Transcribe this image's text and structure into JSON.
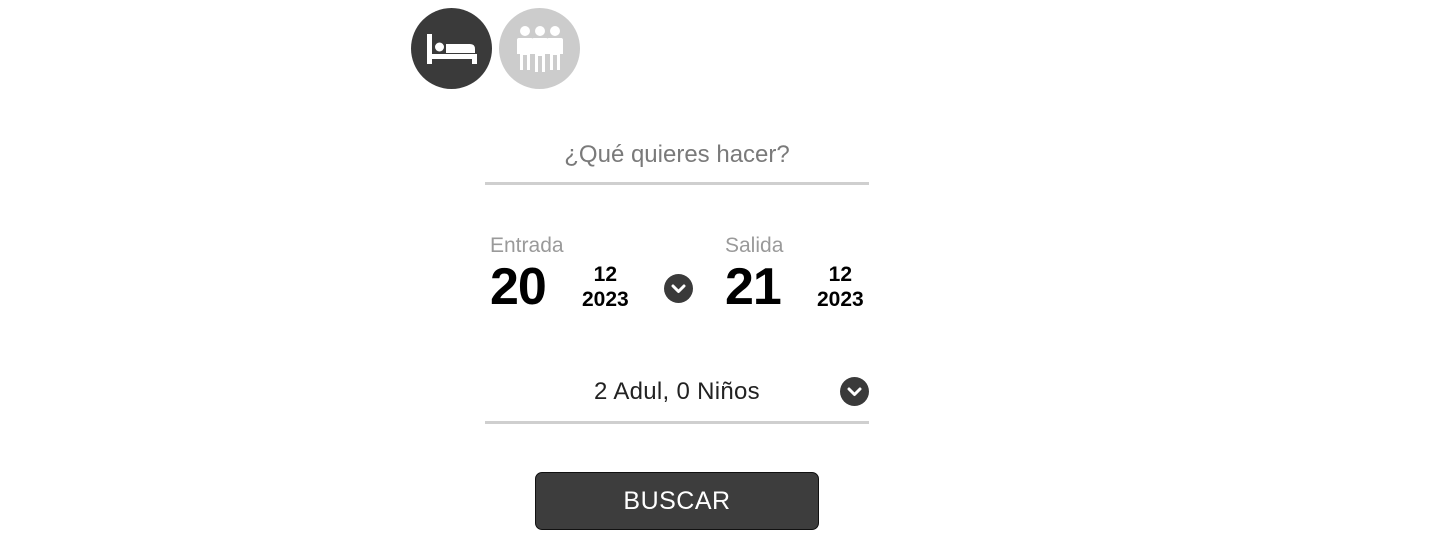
{
  "categories": [
    {
      "icon": "bed-icon",
      "state": "active",
      "color": "#3a3a3a"
    },
    {
      "icon": "people-icon",
      "state": "inactive",
      "color": "#cccccc"
    }
  ],
  "search": {
    "placeholder": "¿Qué quieres hacer?",
    "value": ""
  },
  "dates": {
    "checkin": {
      "label": "Entrada",
      "day": "20",
      "month": "12",
      "year": "2023"
    },
    "checkout": {
      "label": "Salida",
      "day": "21",
      "month": "12",
      "year": "2023"
    },
    "toggle_icon": "chevron-down-icon"
  },
  "guests": {
    "text": "2 Adul, 0 Niños",
    "toggle_icon": "chevron-down-icon"
  },
  "submit": {
    "label": "BUSCAR"
  }
}
